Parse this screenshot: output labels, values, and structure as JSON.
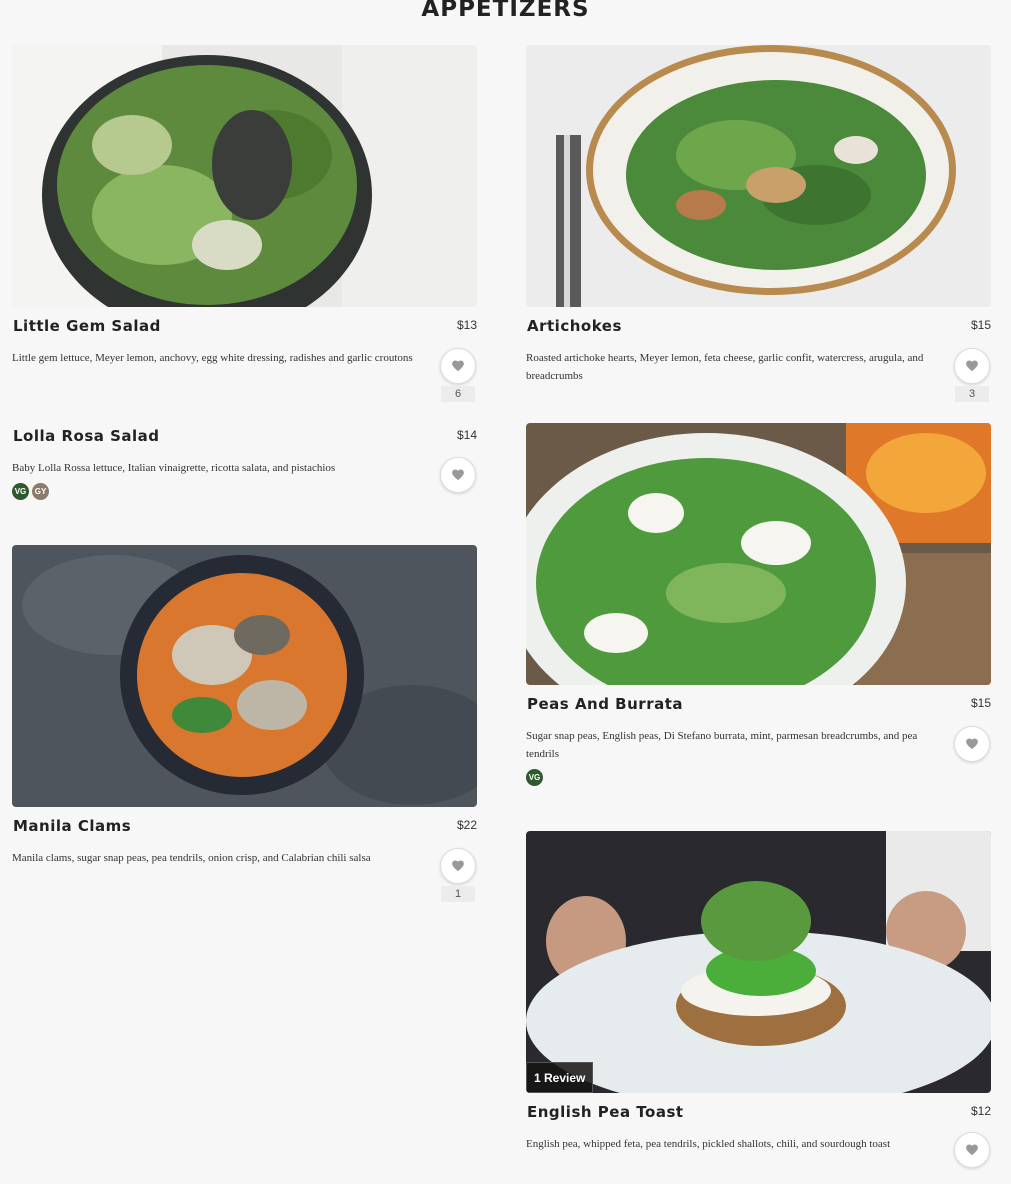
{
  "section": {
    "title": "APPETIZERS"
  },
  "items": [
    {
      "name": "Little Gem Salad",
      "price": "$13",
      "description": "Little gem lettuce, Meyer lemon, anchovy, egg white dressing, radishes and garlic croutons",
      "likes": "6",
      "image": "salad-bowl-photo"
    },
    {
      "name": "Artichokes",
      "price": "$15",
      "description": "Roasted artichoke hearts, Meyer lemon, feta cheese, garlic confit, watercress, arugula, and breadcrumbs",
      "likes": "3",
      "image": "artichoke-plate-photo"
    },
    {
      "name": "Lolla Rosa Salad",
      "price": "$14",
      "description": "Baby Lolla Rossa lettuce, Italian vinaigrette, ricotta salata, and pistachios",
      "tags": [
        "VG",
        "GY"
      ]
    },
    {
      "name": "Peas And Burrata",
      "price": "$15",
      "description": "Sugar snap peas, English peas, Di Stefano burrata, mint, parmesan breadcrumbs, and pea tendrils",
      "tags": [
        "VG"
      ],
      "image": "peas-burrata-photo"
    },
    {
      "name": "Manila Clams",
      "price": "$22",
      "description": "Manila clams, sugar snap peas, pea tendrils, onion crisp, and Calabrian chili salsa",
      "likes": "1",
      "image": "clams-bowl-photo"
    },
    {
      "name": "English Pea Toast",
      "price": "$12",
      "description": "English pea, whipped feta, pea tendrils, pickled shallots, chili, and sourdough toast",
      "review_badge": "1 Review",
      "image": "pea-toast-photo"
    }
  ],
  "colors": {
    "vg_tag": "#2e5a2e",
    "gy_tag": "#8d7b6a",
    "heart": "#999999"
  },
  "icons": {
    "like": "heart-icon"
  }
}
